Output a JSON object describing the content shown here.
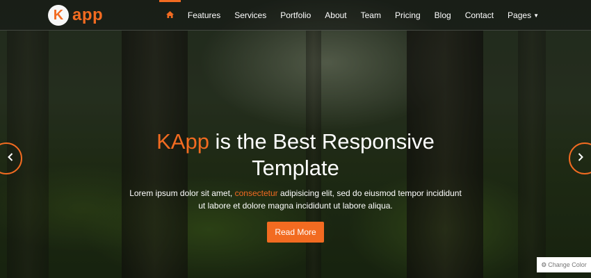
{
  "brand": {
    "badge": "K",
    "name": "app",
    "accent_color": "#f26b21"
  },
  "nav": {
    "home_icon": "home-icon",
    "items": [
      "Features",
      "Services",
      "Portfolio",
      "About",
      "Team",
      "Pricing",
      "Blog",
      "Contact",
      "Pages"
    ],
    "dropdown_icon": "caret-down-icon"
  },
  "hero": {
    "title_brand": "KApp",
    "title_rest": " is the Best Responsive Template",
    "text_before": "Lorem ipsum dolor sit amet, ",
    "text_accent": "consectetur",
    "text_after": " adipisicing elit, sed do eiusmod tempor incididunt ut labore et dolore magna incididunt ut labore aliqua.",
    "button": "Read More"
  },
  "carousel": {
    "prev_icon": "chevron-left-icon",
    "next_icon": "chevron-right-icon"
  },
  "widget": {
    "gear_icon": "gear-icon",
    "label": "Change Color"
  }
}
